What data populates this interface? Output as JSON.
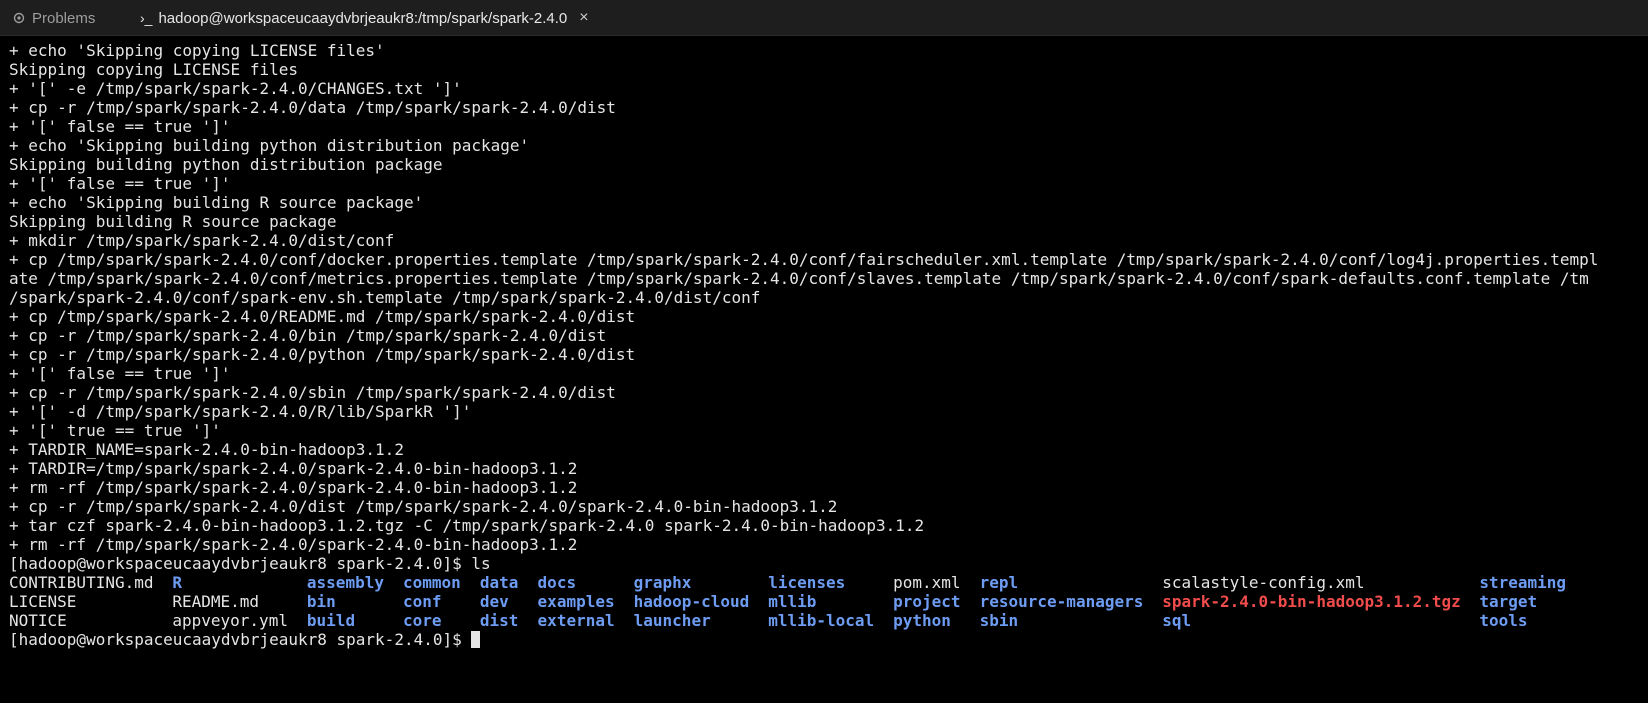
{
  "tabs": {
    "problems_label": "Problems",
    "terminal_prefix": "›_",
    "terminal_label": "hadoop@workspaceucaaydvbrjeaukr8:/tmp/spark/spark-2.4.0",
    "close_glyph": "×"
  },
  "terminal": {
    "lines": [
      "+ echo 'Skipping copying LICENSE files'",
      "Skipping copying LICENSE files",
      "+ '[' -e /tmp/spark/spark-2.4.0/CHANGES.txt ']'",
      "+ cp -r /tmp/spark/spark-2.4.0/data /tmp/spark/spark-2.4.0/dist",
      "+ '[' false == true ']'",
      "+ echo 'Skipping building python distribution package'",
      "Skipping building python distribution package",
      "+ '[' false == true ']'",
      "+ echo 'Skipping building R source package'",
      "Skipping building R source package",
      "+ mkdir /tmp/spark/spark-2.4.0/dist/conf",
      "+ cp /tmp/spark/spark-2.4.0/conf/docker.properties.template /tmp/spark/spark-2.4.0/conf/fairscheduler.xml.template /tmp/spark/spark-2.4.0/conf/log4j.properties.templ",
      "ate /tmp/spark/spark-2.4.0/conf/metrics.properties.template /tmp/spark/spark-2.4.0/conf/slaves.template /tmp/spark/spark-2.4.0/conf/spark-defaults.conf.template /tm",
      "/spark/spark-2.4.0/conf/spark-env.sh.template /tmp/spark/spark-2.4.0/dist/conf",
      "+ cp /tmp/spark/spark-2.4.0/README.md /tmp/spark/spark-2.4.0/dist",
      "+ cp -r /tmp/spark/spark-2.4.0/bin /tmp/spark/spark-2.4.0/dist",
      "+ cp -r /tmp/spark/spark-2.4.0/python /tmp/spark/spark-2.4.0/dist",
      "+ '[' false == true ']'",
      "+ cp -r /tmp/spark/spark-2.4.0/sbin /tmp/spark/spark-2.4.0/dist",
      "+ '[' -d /tmp/spark/spark-2.4.0/R/lib/SparkR ']'",
      "+ '[' true == true ']'",
      "+ TARDIR_NAME=spark-2.4.0-bin-hadoop3.1.2",
      "+ TARDIR=/tmp/spark/spark-2.4.0/spark-2.4.0-bin-hadoop3.1.2",
      "+ rm -rf /tmp/spark/spark-2.4.0/spark-2.4.0-bin-hadoop3.1.2",
      "+ cp -r /tmp/spark/spark-2.4.0/dist /tmp/spark/spark-2.4.0/spark-2.4.0-bin-hadoop3.1.2",
      "+ tar czf spark-2.4.0-bin-hadoop3.1.2.tgz -C /tmp/spark/spark-2.4.0 spark-2.4.0-bin-hadoop3.1.2",
      "+ rm -rf /tmp/spark/spark-2.4.0/spark-2.4.0-bin-hadoop3.1.2",
      "[hadoop@workspaceucaaydvbrjeaukr8 spark-2.4.0]$ ls"
    ],
    "ls_rows": [
      [
        {
          "text": "CONTRIBUTING.md",
          "kind": "file"
        },
        {
          "text": "R",
          "kind": "dir"
        },
        {
          "text": "assembly",
          "kind": "dir"
        },
        {
          "text": "common",
          "kind": "dir"
        },
        {
          "text": "data",
          "kind": "dir"
        },
        {
          "text": "docs",
          "kind": "dir"
        },
        {
          "text": "graphx",
          "kind": "dir"
        },
        {
          "text": "licenses",
          "kind": "dir"
        },
        {
          "text": "pom.xml",
          "kind": "file"
        },
        {
          "text": "repl",
          "kind": "dir"
        },
        {
          "text": "scalastyle-config.xml",
          "kind": "file"
        },
        {
          "text": "streaming",
          "kind": "dir"
        }
      ],
      [
        {
          "text": "LICENSE",
          "kind": "file"
        },
        {
          "text": "README.md",
          "kind": "file"
        },
        {
          "text": "bin",
          "kind": "dir"
        },
        {
          "text": "conf",
          "kind": "dir"
        },
        {
          "text": "dev",
          "kind": "dir"
        },
        {
          "text": "examples",
          "kind": "dir"
        },
        {
          "text": "hadoop-cloud",
          "kind": "dir"
        },
        {
          "text": "mllib",
          "kind": "dir"
        },
        {
          "text": "project",
          "kind": "dir"
        },
        {
          "text": "resource-managers",
          "kind": "dir"
        },
        {
          "text": "spark-2.4.0-bin-hadoop3.1.2.tgz",
          "kind": "archive"
        },
        {
          "text": "target",
          "kind": "dir"
        }
      ],
      [
        {
          "text": "NOTICE",
          "kind": "file"
        },
        {
          "text": "appveyor.yml",
          "kind": "file"
        },
        {
          "text": "build",
          "kind": "dir"
        },
        {
          "text": "core",
          "kind": "dir"
        },
        {
          "text": "dist",
          "kind": "dir"
        },
        {
          "text": "external",
          "kind": "dir"
        },
        {
          "text": "launcher",
          "kind": "dir"
        },
        {
          "text": "mllib-local",
          "kind": "dir"
        },
        {
          "text": "python",
          "kind": "dir"
        },
        {
          "text": "sbin",
          "kind": "dir"
        },
        {
          "text": "sql",
          "kind": "dir"
        },
        {
          "text": "tools",
          "kind": "dir"
        }
      ]
    ],
    "prompt": "[hadoop@workspaceucaaydvbrjeaukr8 spark-2.4.0]$ ",
    "colors": {
      "background": "#000000",
      "text": "#e5e5e5",
      "directory": "#6d9cf2",
      "archive": "#f14c4c"
    }
  }
}
